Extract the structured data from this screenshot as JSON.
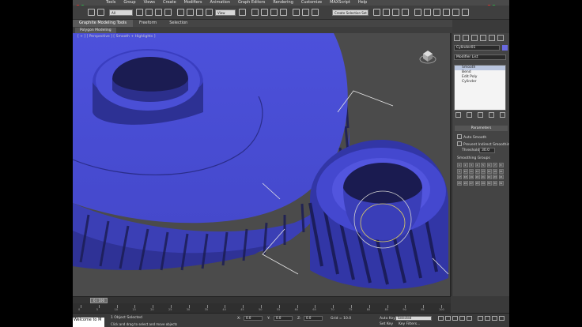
{
  "menu": {
    "items": [
      "Tools",
      "Group",
      "Views",
      "Create",
      "Modifiers",
      "Animation",
      "Graph Editors",
      "Rendering",
      "Customize",
      "MAXScript",
      "Help"
    ]
  },
  "toolbar": {
    "selection_filter": "All",
    "reference_coord": "View",
    "named_selection": "Create Selection Set"
  },
  "ribbon": {
    "tabs": [
      "Graphite Modeling Tools",
      "Freeform",
      "Selection"
    ],
    "panel_label": "Polygon Modeling"
  },
  "viewport": {
    "label": "[ + ] [ Perspective ] [ Smooth + Highlights ]",
    "colors": {
      "gear": "#4a4fd9",
      "background": "#4b4b4b"
    }
  },
  "command_panel": {
    "object_name": "Cylinder01",
    "modifier_list": "Modifier List",
    "stack": [
      "Smooth",
      "Bend",
      "Edit Poly",
      "Cylinder"
    ],
    "rollout_title": "Parameters",
    "auto_smooth": "Auto Smooth",
    "prevent_indirect": "Prevent Indirect Smoothing",
    "threshold_label": "Threshold:",
    "threshold_value": "30.0",
    "smoothing_groups_label": "Smoothing Groups",
    "groups": [
      "1",
      "2",
      "3",
      "4",
      "5",
      "6",
      "7",
      "8",
      "9",
      "10",
      "11",
      "12",
      "13",
      "14",
      "15",
      "16",
      "17",
      "18",
      "19",
      "20",
      "21",
      "22",
      "23",
      "24",
      "25",
      "26",
      "27",
      "28",
      "29",
      "30",
      "31",
      "32"
    ]
  },
  "timeline": {
    "frame": "0 / 100",
    "ticks": [
      "0",
      "5",
      "10",
      "15",
      "20",
      "25",
      "30",
      "35",
      "40",
      "45",
      "50",
      "55",
      "60",
      "65",
      "70",
      "75",
      "80",
      "85",
      "90",
      "95",
      "100"
    ]
  },
  "status": {
    "maxscript": "Welcome to M",
    "selected": "1 Object Selected",
    "prompt": "Click and drag to select and move objects",
    "x_label": "X:",
    "x_value": "0.0",
    "y_label": "Y:",
    "y_value": "0.0",
    "z_label": "Z:",
    "z_value": "0.0",
    "grid": "Grid = 10.0",
    "auto_key": "Auto Key",
    "set_key": "Set Key",
    "selected_dropdown": "Selected",
    "key_filters": "Key Filters..."
  }
}
